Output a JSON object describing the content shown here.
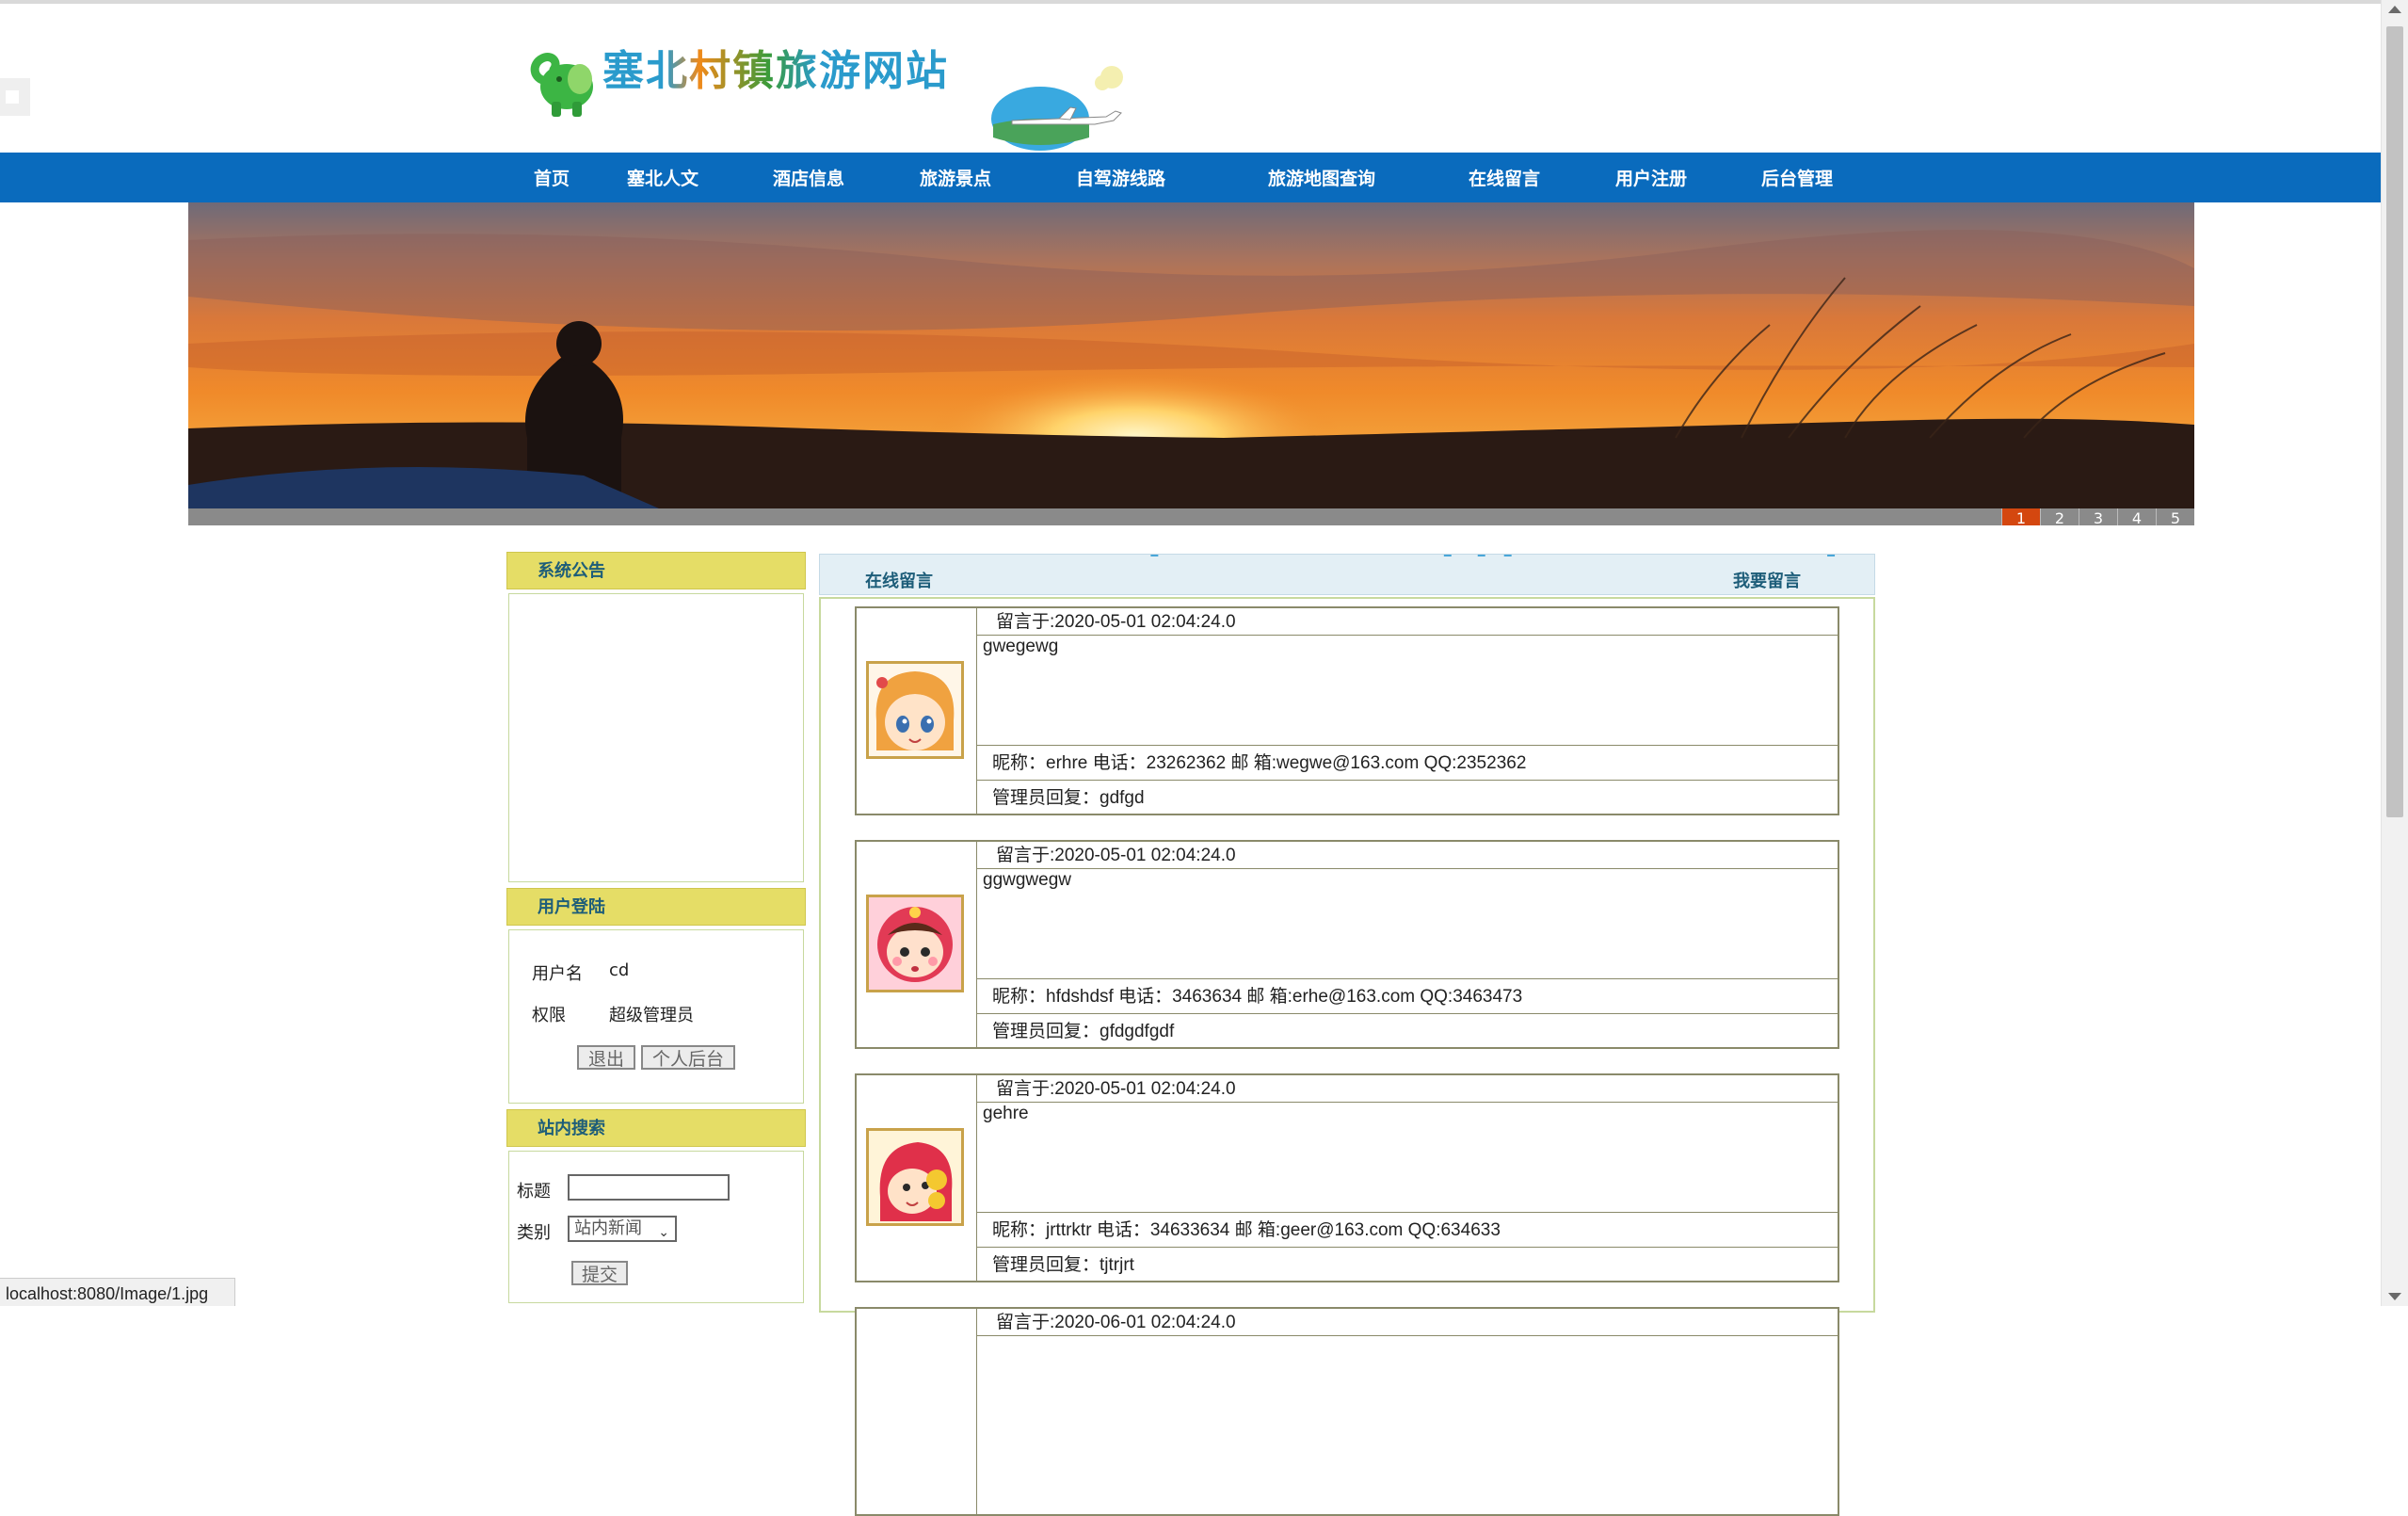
{
  "site": {
    "title": "塞北村镇旅游网站"
  },
  "nav": [
    {
      "label": "首页"
    },
    {
      "label": "塞北人文"
    },
    {
      "label": "酒店信息"
    },
    {
      "label": "旅游景点"
    },
    {
      "label": "自驾游线路"
    },
    {
      "label": "旅游地图查询"
    },
    {
      "label": "在线留言"
    },
    {
      "label": "用户注册"
    },
    {
      "label": "后台管理"
    }
  ],
  "banner": {
    "pages": [
      "1",
      "2",
      "3",
      "4",
      "5"
    ],
    "active_page": "1"
  },
  "sidebar": {
    "notice": {
      "title": "系统公告"
    },
    "login": {
      "title": "用户登陆",
      "username_label": "用户名",
      "username": "cd",
      "role_label": "权限",
      "role": "超级管理员",
      "logout_button": "退出",
      "backend_button": "个人后台"
    },
    "search": {
      "title": "站内搜索",
      "title_label": "标题",
      "title_value": "",
      "category_label": "类别",
      "category_selected": "站内新闻",
      "submit_button": "提交"
    }
  },
  "main": {
    "title": "在线留言",
    "action": "我要留言",
    "messages": [
      {
        "time": "留言于:2020-05-01 02:04:24.0",
        "content": "gwegewg",
        "info": "昵称：erhre    电话：23262362  邮 箱:wegwe@163.com   QQ:2352362",
        "reply": "管理员回复：gdfgd",
        "avatar": "girl-avatar"
      },
      {
        "time": "留言于:2020-05-01 02:04:24.0",
        "content": "ggwgwegw",
        "info": "昵称：hfdshdsf    电话：3463634  邮 箱:erhe@163.com   QQ:3463473",
        "reply": "管理员回复：gfdgdfgdf",
        "avatar": "baby-avatar"
      },
      {
        "time": "留言于:2020-05-01 02:04:24.0",
        "content": "gehre",
        "info": "昵称：jrttrktr    电话：34633634  邮 箱:geer@163.com   QQ:634633",
        "reply": "管理员回复：tjtrjrt",
        "avatar": "hooded-avatar"
      },
      {
        "time": "留言于:2020-06-01 02:04:24.0"
      }
    ]
  },
  "status_url": "localhost:8080/Image/1.jpg",
  "colors": {
    "nav_bg": "#0a6bbd",
    "box_header": "#e5dd66",
    "heading_text": "#1d5d79",
    "active_page": "#d4470f"
  }
}
